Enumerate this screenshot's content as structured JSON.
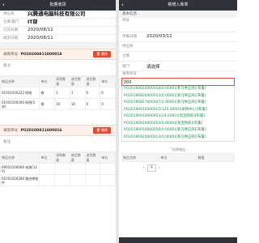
{
  "left": {
    "title": "批量收货",
    "fields": [
      {
        "label": "供应商",
        "value": "兴腾通电脑科技有限公司"
      },
      {
        "label": "仓库/部门",
        "value": "IT部"
      },
      {
        "label": "订货日期",
        "value": "2020/08/11"
      },
      {
        "label": "收货日期",
        "value": "2020/08/11"
      }
    ],
    "po_blocks": [
      {
        "po_label": "采购单号:",
        "po_number": "PO20200811000018",
        "delete_label": "删除",
        "remark_label": "备注",
        "columns": [
          "物品名称",
          "单位",
          "采购数量",
          "收货数量",
          "退货数量",
          "单价"
        ],
        "rows": [
          [
            "01010100222 网线",
            "卷",
            "1",
            "1",
            "0",
            "0"
          ],
          [
            "01010100300 网线(5米)",
            "根",
            "10",
            "10",
            "0",
            "0"
          ]
        ]
      },
      {
        "po_label": "采购单号:",
        "po_number": "PO20200811000016",
        "delete_label": "删除",
        "remark_label": "备注",
        "columns": [
          "物品名称",
          "单位",
          "采购数量",
          "收货数量",
          "退货数量",
          "单价"
        ],
        "rows": [
          [
            "09010100066 电源(12V)",
            "",
            "",
            "",
            "",
            ""
          ],
          [
            "01010100286 路由带铁件",
            "",
            "",
            "",
            "",
            ""
          ]
        ]
      }
    ]
  },
  "right": {
    "title": "新增入库单",
    "section": "基本信息",
    "fields": {
      "order_no_label": "单号",
      "date_label": "单据日期",
      "date_value": "2020/03/11",
      "supplier_label": "供应商",
      "warehouse_label": "仓库",
      "dept_label": "部门",
      "dept_value": "请选择",
      "po_label": "采购单号"
    },
    "search_value": "000",
    "suggestions": [
      "PO20190810000018(0.0000)[莱马供应商][布鲁]",
      "PO20190820000013(0.0000)[莱马供应商][布鲁]",
      "PO20190827000047(2.0000)[莱马供应商][布鲁]",
      "PO20190910000015(120.0000)[采购中心][布鲁]",
      "PO20190910000053(24.0000)[淘宝网商][布鲁]",
      "PO20190910000054(0.0000)[淘宝网商][布鲁]",
      "PO20190910000056(0.0000)[莱马供应商][布鲁]",
      "PO20190920000013(0.0000)[莱马供应商][布鲁]"
    ],
    "footnote": "*选择物品",
    "table_headers": [
      "物品名称",
      "单位",
      "数量"
    ],
    "pager_page": "9",
    "pager_prev": "‹",
    "pager_next": "›"
  },
  "colors": {
    "accent": "#e34a35",
    "suggest_text": "#1f8f4e",
    "titlebar": "#2f3339"
  }
}
